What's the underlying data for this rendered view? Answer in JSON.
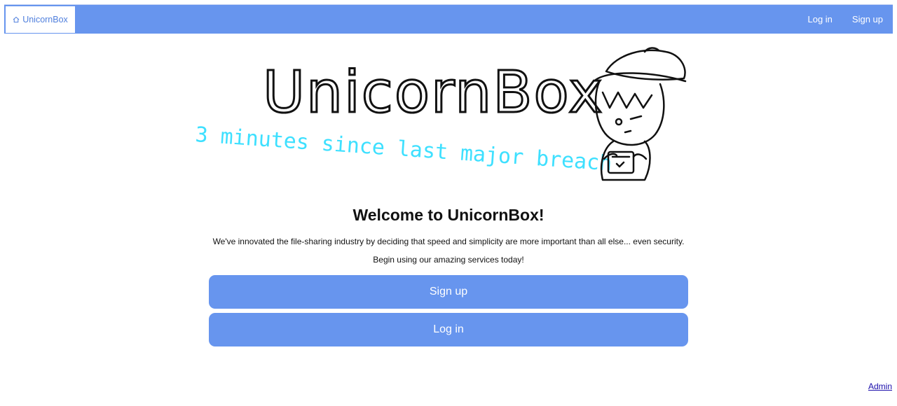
{
  "navbar": {
    "brand_label": "UnicornBox",
    "brand_icon": "house-icon",
    "login_label": "Log in",
    "signup_label": "Sign up"
  },
  "hero": {
    "logo_text": "UnicornBox",
    "tagline": "3 minutes since last major breach"
  },
  "main": {
    "welcome_title": "Welcome to UnicornBox!",
    "description": "We've innovated the file-sharing industry by deciding that speed and simplicity are more important than all else... even security.",
    "begin_text": "Begin using our amazing services today!",
    "signup_button": "Sign up",
    "login_button": "Log in"
  },
  "footer": {
    "admin_link": "Admin"
  },
  "colors": {
    "accent": "#6795ee",
    "tagline": "#3ee0ff",
    "link": "#1a0dab"
  }
}
